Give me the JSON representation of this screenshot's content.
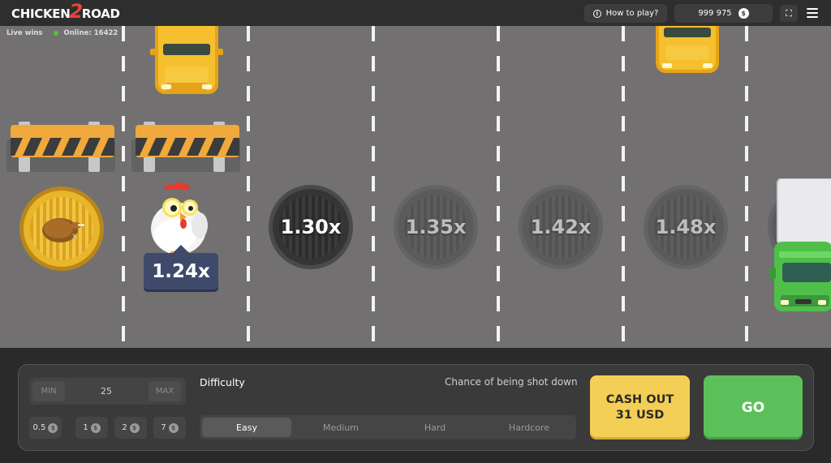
{
  "header": {
    "logo_left": "CHICKEN",
    "logo_mid": "2",
    "logo_right": "ROAD",
    "how_to_play": "How to play?",
    "balance": "999 975",
    "currency_icon": "dollar-coin-icon"
  },
  "status": {
    "live_wins": "Live wins",
    "online": "Online: 16422"
  },
  "road": {
    "current_multiplier": "1.24x",
    "manholes": [
      {
        "label": "1.30x"
      },
      {
        "label": "1.35x"
      },
      {
        "label": "1.42x"
      },
      {
        "label": "1.48x"
      }
    ]
  },
  "controls": {
    "min_label": "MIN",
    "max_label": "MAX",
    "bet_value": "25",
    "chips": [
      {
        "label": "0.5"
      },
      {
        "label": "1"
      },
      {
        "label": "2"
      },
      {
        "label": "7"
      }
    ],
    "difficulty_title": "Difficulty",
    "chance_label": "Chance of being shot down",
    "difficulties": [
      {
        "label": "Easy",
        "active": true
      },
      {
        "label": "Medium",
        "active": false
      },
      {
        "label": "Hard",
        "active": false
      },
      {
        "label": "Hardcore",
        "active": false
      }
    ],
    "cashout_line1": "CASH OUT",
    "cashout_line2": "31 USD",
    "go_label": "GO"
  },
  "colors": {
    "road": "#727070",
    "cashout": "#f4cf55",
    "go": "#5cc05a",
    "multiplier_label": "#3f4a6b"
  }
}
